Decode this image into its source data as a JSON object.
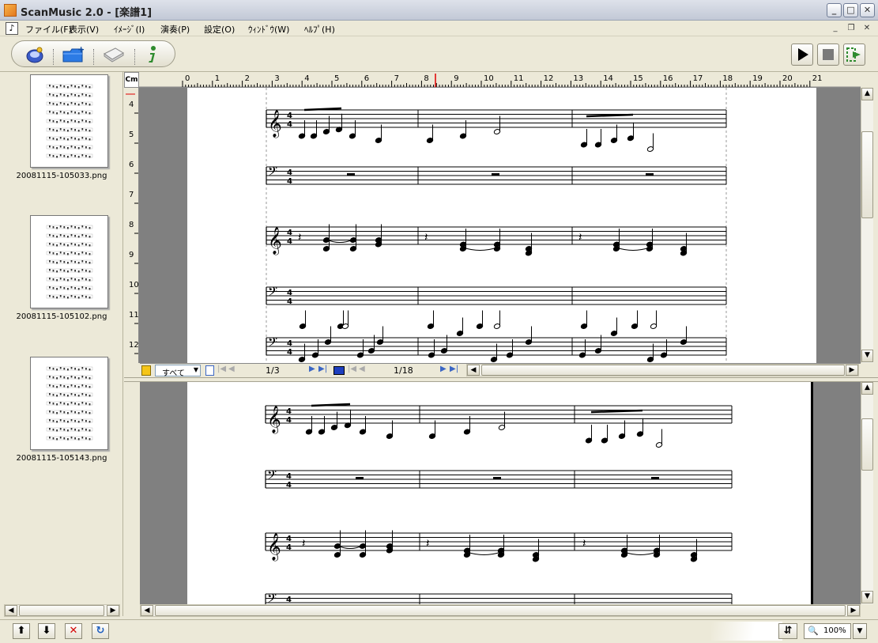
{
  "window": {
    "title": "ScanMusic 2.0 - [楽譜1]"
  },
  "menu": {
    "items": [
      "ファイル(F)",
      "表示(V)",
      "ｲﾒｰｼﾞ(I)",
      "演奏(P)",
      "設定(O)",
      "ｳｨﾝﾄﾞｳ(W)",
      "ﾍﾙﾌﾟ(H)"
    ]
  },
  "thumbnails": [
    {
      "filename": "20081115-105033.png"
    },
    {
      "filename": "20081115-105102.png"
    },
    {
      "filename": "20081115-105143.png"
    }
  ],
  "ruler": {
    "unit": "Cm",
    "horizontal_ticks": [
      "0",
      "1",
      "2",
      "3",
      "4",
      "5",
      "6",
      "7",
      "8",
      "9",
      "10",
      "11",
      "12",
      "13",
      "14",
      "15",
      "16",
      "17",
      "18",
      "19",
      "20",
      "21"
    ],
    "vertical_ticks": [
      "4",
      "5",
      "6",
      "7",
      "8",
      "9",
      "10",
      "11",
      "12"
    ]
  },
  "navigation": {
    "filter_value": "すべて",
    "page_counter": "1/3",
    "measure_counter": "1/18"
  },
  "status": {
    "zoom": "100%"
  },
  "icons": {
    "toolbar": [
      "scan-icon",
      "open-folder-icon",
      "scanner-icon",
      "info-icon"
    ],
    "playback": [
      "play-icon",
      "stop-icon",
      "export-icon"
    ],
    "status": [
      "up-arrow-icon",
      "down-arrow-icon",
      "delete-icon",
      "rotate-icon"
    ]
  },
  "colors": {
    "titlebar": "#c2c9d6",
    "window_bg": "#ece9d8",
    "workspace": "#808080",
    "info_green": "#2e8b2e",
    "delete_red": "#d40000",
    "folder_blue": "#2c7be5"
  }
}
